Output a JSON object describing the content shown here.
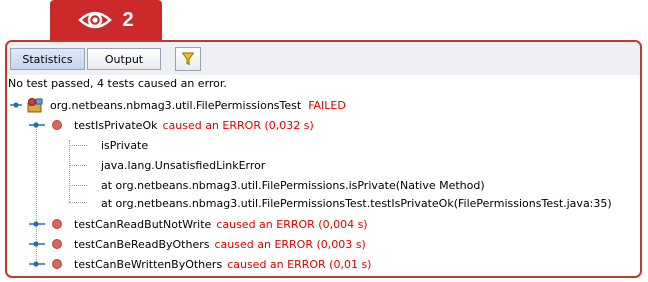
{
  "badge": {
    "number": "2",
    "icon": "eye-icon"
  },
  "toolbar": {
    "tabs": [
      {
        "label": "Statistics"
      },
      {
        "label": "Output"
      }
    ],
    "filter_icon": "filter-funnel-icon"
  },
  "summary": "No test passed, 4 tests caused an error.",
  "suite": {
    "name": "org.netbeans.nbmag3.util.FilePermissionsTest",
    "status": "FAILED"
  },
  "tests": [
    {
      "name": "testIsPrivateOk",
      "status": "caused an ERROR  (0,032 s)",
      "details": [
        "isPrivate",
        "java.lang.UnsatisfiedLinkError",
        "at org.netbeans.nbmag3.util.FilePermissions.isPrivate(Native Method)",
        "at org.netbeans.nbmag3.util.FilePermissionsTest.testIsPrivateOk(FilePermissionsTest.java:35)"
      ]
    },
    {
      "name": "testCanReadButNotWrite",
      "status": "caused an ERROR  (0,004 s)"
    },
    {
      "name": "testCanBeReadByOthers",
      "status": "caused an ERROR  (0,003 s)"
    },
    {
      "name": "testCanBeWrittenByOthers",
      "status": "caused an ERROR  (0,01 s)"
    }
  ],
  "colors": {
    "accent": "#cc2a2a",
    "error": "#e00000",
    "frame": "#c0392b"
  }
}
